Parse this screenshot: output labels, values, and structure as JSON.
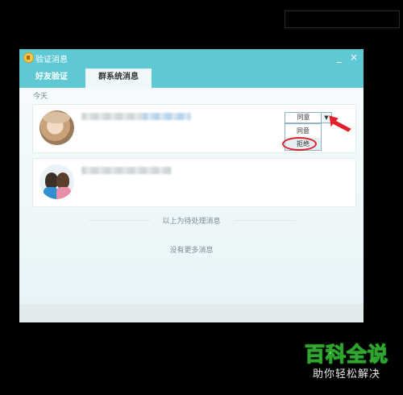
{
  "window": {
    "title": "验证消息",
    "minimize_symbol": "_",
    "close_symbol": "×"
  },
  "tabs": [
    {
      "label": "好友验证",
      "active": false
    },
    {
      "label": "群系统消息",
      "active": true
    }
  ],
  "content": {
    "day_label": "今天",
    "requests": [
      {
        "action": {
          "selected": "同意",
          "options": [
            "同意",
            "拒绝"
          ],
          "dropdown_open": true,
          "highlighted_option": "拒绝"
        }
      },
      {}
    ],
    "divider_text": "以上为待处理消息",
    "no_more_text": "没有更多消息"
  },
  "watermark": {
    "title": "百科全说",
    "subtitle": "助你轻松解决"
  },
  "colors": {
    "titlebar": "#5ec9d5",
    "annotation_red": "#e0202a",
    "watermark_green": "#2fa52f"
  },
  "icons": {
    "title": "speaker-icon",
    "dropdown": "chevron-down-icon"
  }
}
